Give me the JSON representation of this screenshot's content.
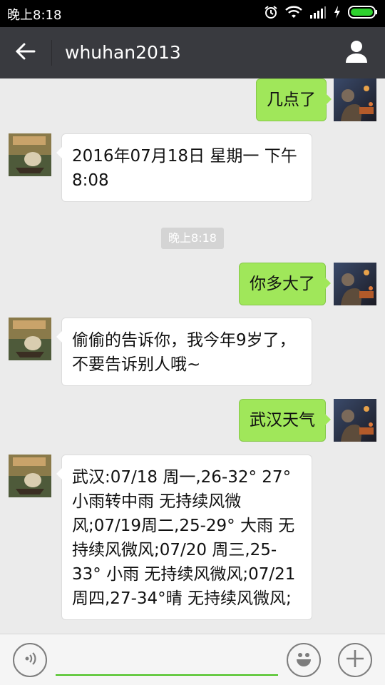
{
  "status_bar": {
    "time": "晚上8:18"
  },
  "header": {
    "title": "whuhan2013"
  },
  "messages": [
    {
      "from": "me",
      "text": "几点了"
    },
    {
      "from": "bot",
      "text": "2016年07月18日 星期一 下午8:08"
    },
    {
      "type": "timestamp",
      "text": "晚上8:18"
    },
    {
      "from": "me",
      "text": "你多大了"
    },
    {
      "from": "bot",
      "text": "偷偷的告诉你，我今年9岁了，不要告诉别人哦~"
    },
    {
      "from": "me",
      "text": "武汉天气"
    },
    {
      "from": "bot",
      "text": "武汉:07/18 周一,26-32° 27° 小雨转中雨 无持续风微风;07/19周二,25-29° 大雨 无持续风微风;07/20 周三,25-33° 小雨 无持续风微风;07/21 周四,27-34°晴 无持续风微风;"
    }
  ],
  "input": {
    "value": "",
    "placeholder": ""
  },
  "icons": {
    "back": "back-arrow-icon",
    "profile": "person-icon",
    "voice": "voice-icon",
    "emoji": "emoji-icon",
    "more": "plus-icon",
    "alarm": "alarm-icon",
    "wifi": "wifi-icon",
    "signal": "signal-icon",
    "battery": "battery-icon"
  },
  "colors": {
    "header_bg": "#393a3f",
    "sent_bubble": "#a0e75a",
    "received_bubble": "#ffffff",
    "chat_bg": "#ebebeb",
    "input_underline": "#45c01a",
    "battery": "#2ed12e"
  }
}
